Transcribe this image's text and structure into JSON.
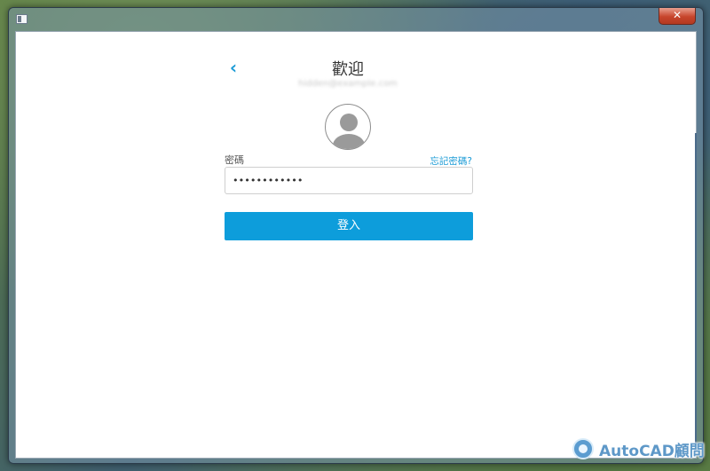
{
  "window": {
    "close_label": "✕"
  },
  "header": {
    "back_icon": "chevron-left-icon",
    "back_glyph": "‹",
    "title": "歡迎",
    "email": "hidden@example.com"
  },
  "avatar": {
    "icon": "user-avatar-icon"
  },
  "password": {
    "label": "密碼",
    "forgot_link": "忘記密碼?",
    "value": "••••••••••••"
  },
  "login_button": {
    "label": "登入"
  },
  "watermark": {
    "text": "AutoCAD顧問"
  },
  "colors": {
    "accent": "#0d9ddb",
    "link": "#1b9bd6",
    "close": "#c7452c"
  }
}
